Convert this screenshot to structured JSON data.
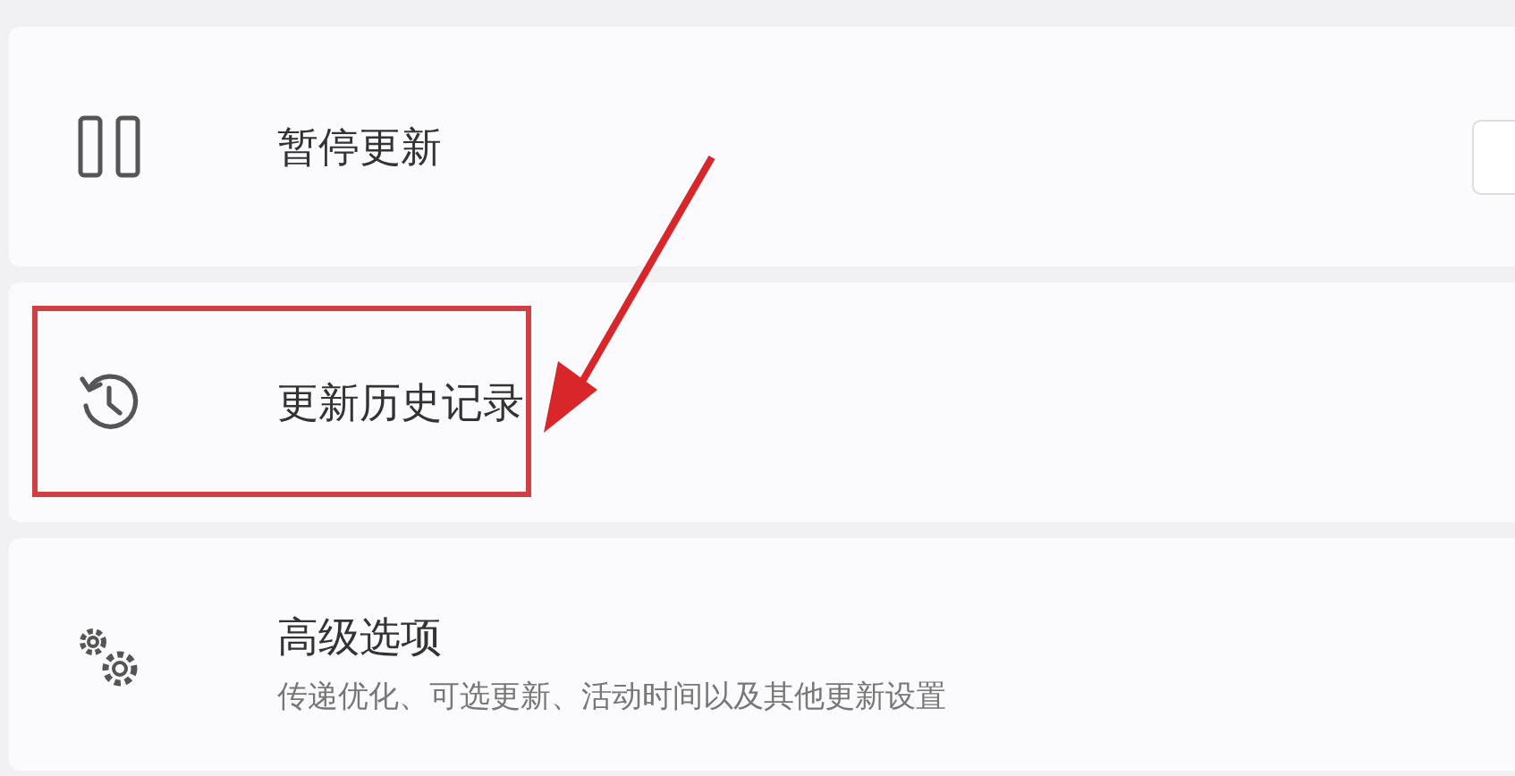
{
  "settings_items": [
    {
      "kind": "pause",
      "title": "暂停更新",
      "highlighted": false,
      "has_button": true
    },
    {
      "kind": "history",
      "title": "更新历史记录",
      "highlighted": true,
      "has_button": false
    },
    {
      "kind": "advanced",
      "title": "高级选项",
      "subtitle": "传递优化、可选更新、活动时间以及其他更新设置",
      "highlighted": false,
      "has_button": false
    }
  ]
}
